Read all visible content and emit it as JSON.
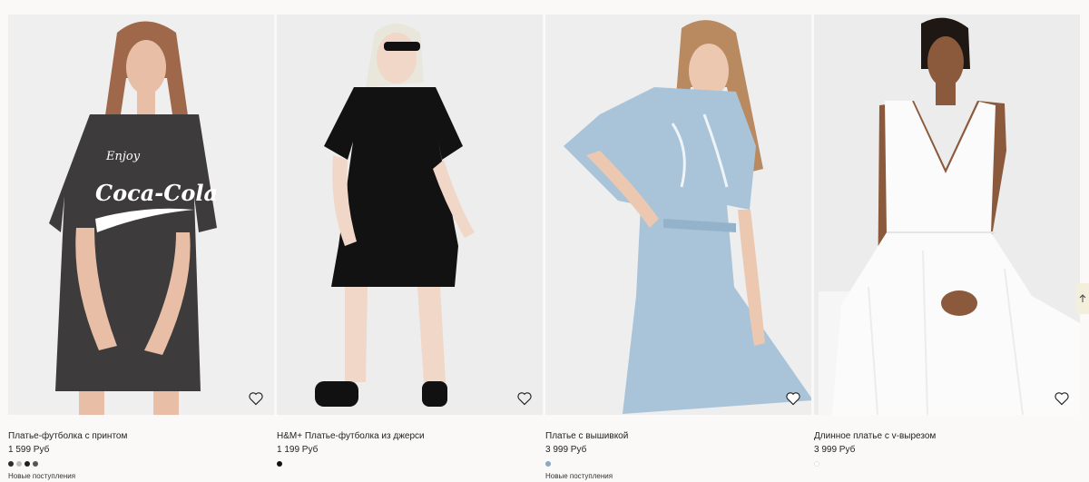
{
  "products": [
    {
      "title": "Платье-футболка с принтом",
      "price": "1 599 Руб",
      "badge": "Новые поступления",
      "photo_bg": "#efefef",
      "garment_color": "#3d3b3c",
      "print_text": [
        "Enjoy",
        "Coca-Cola"
      ],
      "swatches": [
        "#2b2b2b",
        "#bdbdbd",
        "#1f1f1f",
        "#555555"
      ]
    },
    {
      "title": "H&M+ Платье-футболка из джерси",
      "price": "1 199 Руб",
      "badge": "",
      "photo_bg": "#ededed",
      "garment_color": "#121212",
      "swatches": [
        "#111111"
      ]
    },
    {
      "title": "Платье с вышивкой",
      "price": "3 999 Руб",
      "badge": "Новые поступления",
      "photo_bg": "#eeeeee",
      "garment_color": "#a9c3d9",
      "swatches": [
        "#8aa7c4"
      ]
    },
    {
      "title": "Длинное платье с v-вырезом",
      "price": "3 999 Руб",
      "badge": "",
      "photo_bg": "#ececec",
      "garment_color": "#fbfbfb",
      "swatches": [
        "#ffffff"
      ]
    }
  ],
  "icons": {
    "favorite": "heart-icon",
    "scroll_top": "arrow-up-icon"
  }
}
